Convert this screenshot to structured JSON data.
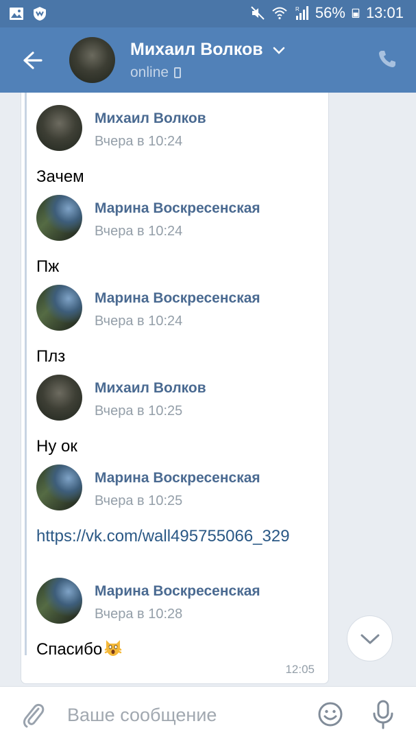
{
  "status_bar": {
    "battery": "56%",
    "time": "13:01",
    "signal_label": "R"
  },
  "header": {
    "contact_name": "Михаил Волков",
    "status": "online"
  },
  "messages": [
    {
      "sender": "Михаил Волков",
      "time": "Вчера в 10:24",
      "text": "Зачем"
    },
    {
      "sender": "Марина Воскресенская",
      "time": "Вчера в 10:24",
      "text": "Пж"
    },
    {
      "sender": "Марина Воскресенская",
      "time": "Вчера в 10:24",
      "text": "Плз"
    },
    {
      "sender": "Михаил Волков",
      "time": "Вчера в 10:25",
      "text": "Ну ок"
    },
    {
      "sender": "Марина Воскресенская",
      "time": "Вчера в 10:25",
      "text": "https://vk.com/wall495755066_329"
    },
    {
      "sender": "Марина Воскресенская",
      "time": "Вчера в 10:28",
      "text": "Спасибо"
    }
  ],
  "card_time": "12:05",
  "composer": {
    "placeholder": "Ваше сообщение"
  },
  "colors": {
    "header_bg": "#5181b8",
    "status_bar_bg": "#4a76a8",
    "link": "#2a5885",
    "sender_name": "#4a6a91"
  }
}
